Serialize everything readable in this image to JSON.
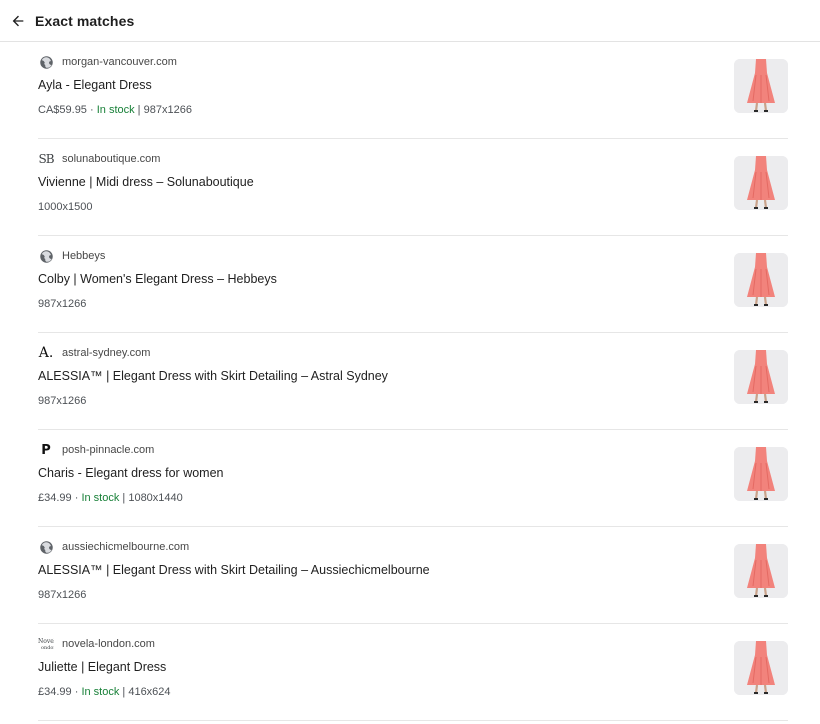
{
  "header": {
    "title": "Exact matches",
    "back_icon": "arrow-back-icon"
  },
  "colors": {
    "in_stock": "#188038",
    "divider": "#e6e6e6",
    "dress": "#f2837c"
  },
  "results": [
    {
      "favicon": "globe-icon",
      "site": "morgan-vancouver.com",
      "title": "Ayla - Elegant Dress",
      "price": "CA$59.95",
      "stock": "In stock",
      "size": "987x1266"
    },
    {
      "favicon_text": "SB",
      "site": "solunaboutique.com",
      "title": "Vivienne | Midi dress – Solunaboutique",
      "size": "1000x1500"
    },
    {
      "favicon": "globe-icon",
      "site": "Hebbeys",
      "title": "Colby | Women's Elegant Dress – Hebbeys",
      "size": "987x1266"
    },
    {
      "favicon_text": "A.",
      "site": "astral-sydney.com",
      "title": "ALESSIA™ | Elegant Dress with Skirt Detailing – Astral Sydney",
      "size": "987x1266"
    },
    {
      "favicon_text": "P",
      "site": "posh-pinnacle.com",
      "title": "Charis - Elegant dress for women",
      "price": "£34.99",
      "stock": "In stock",
      "size": "1080x1440"
    },
    {
      "favicon": "globe-icon",
      "site": "aussiechicmelbourne.com",
      "title": "ALESSIA™ | Elegant Dress with Skirt Detailing – Aussiechicmelbourne",
      "size": "987x1266"
    },
    {
      "favicon": "novela-logo-icon",
      "site": "novela-london.com",
      "title": "Juliette | Elegant Dress",
      "price": "£34.99",
      "stock": "In stock",
      "size": "416x624"
    }
  ]
}
